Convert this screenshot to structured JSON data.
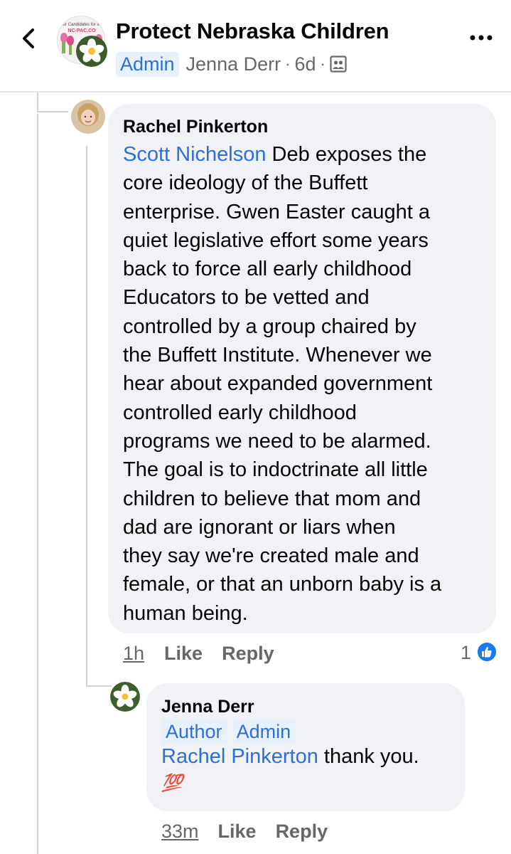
{
  "header": {
    "group_name": "Protect Nebraska Children",
    "avatar_banner_text": "our Candidates for Ma",
    "avatar_logo_text": "NC-PAC.CO",
    "role_badge": "Admin",
    "poster_name": "Jenna Derr",
    "separator": "·",
    "age": "6d"
  },
  "comments": [
    {
      "author": "Rachel Pinkerton",
      "mention": "Scott Nichelson",
      "lines": [
        " Deb exposes the",
        "core ideology of the Buffett",
        "enterprise. Gwen Easter caught a",
        "quiet legislative effort some years",
        "back to force all early childhood",
        "Educators to be vetted and",
        "controlled by a group chaired by",
        "the Buffett Institute. Whenever we",
        "hear about expanded government",
        "controlled early childhood",
        "programs we need to be alarmed.",
        "The goal is to indoctrinate all little",
        "children to believe that mom and",
        "dad are ignorant  or liars when",
        "they say we're created male and",
        "female, or that an unborn baby is a",
        "human being."
      ],
      "time": "1h",
      "like_label": "Like",
      "reply_label": "Reply",
      "reaction_count": "1"
    },
    {
      "author": "Jenna Derr",
      "badges": [
        "Author",
        "Admin"
      ],
      "mention": "Rachel Pinkerton",
      "text": " thank you.",
      "emoji": "💯",
      "time": "33m",
      "like_label": "Like",
      "reply_label": "Reply"
    }
  ],
  "colors": {
    "accent": "#2d6fd6",
    "bubble": "#f0f2f5",
    "muted": "#65676b",
    "like_blue": "#1877f2"
  }
}
